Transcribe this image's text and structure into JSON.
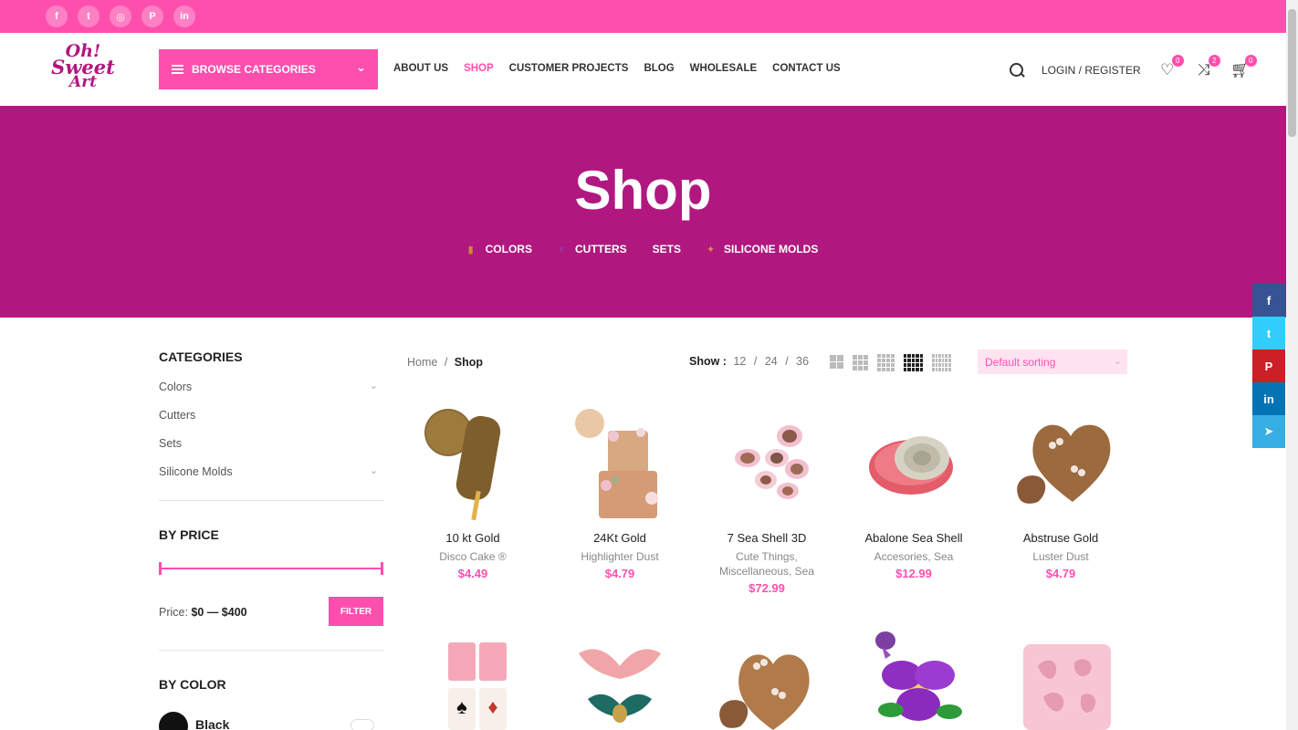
{
  "topbar": {
    "social": [
      {
        "icon": "facebook-icon",
        "glyph": "f"
      },
      {
        "icon": "twitter-icon",
        "glyph": "t"
      },
      {
        "icon": "instagram-icon",
        "glyph": "◎"
      },
      {
        "icon": "pinterest-icon",
        "glyph": "P"
      },
      {
        "icon": "linkedin-icon",
        "glyph": "in"
      }
    ]
  },
  "header": {
    "logo": {
      "line1": "Oh!",
      "line2": "Sweet",
      "line3": "Art"
    },
    "browse_label": "BROWSE CATEGORIES",
    "nav": [
      "ABOUT US",
      "SHOP",
      "CUSTOMER PROJECTS",
      "BLOG",
      "WHOLESALE",
      "CONTACT US"
    ],
    "active_nav": "SHOP",
    "login_label": "LOGIN / REGISTER",
    "wishlist_count": "0",
    "compare_count": "2",
    "cart_count": "0"
  },
  "hero": {
    "title": "Shop",
    "categories": [
      "COLORS",
      "CUTTERS",
      "SETS",
      "SILICONE MOLDS"
    ]
  },
  "sidebar": {
    "categories_title": "CATEGORIES",
    "categories": [
      "Colors",
      "Cutters",
      "Sets",
      "Silicone Molds"
    ],
    "price_title": "BY PRICE",
    "price_prefix": "Price:",
    "price_range": "$0 — $400",
    "filter_label": "FILTER",
    "color_title": "BY COLOR",
    "first_color": "Black"
  },
  "toolbar": {
    "breadcrumb_home": "Home",
    "breadcrumb_sep": "/",
    "breadcrumb_current": "Shop",
    "show_label": "Show :",
    "show_options": [
      "12",
      "24",
      "36"
    ],
    "sort_label": "Default sorting"
  },
  "products": [
    {
      "name": "10 kt Gold",
      "category": "Disco Cake ®",
      "price": "$4.49"
    },
    {
      "name": "24Kt Gold",
      "category": "Highlighter Dust",
      "price": "$4.79"
    },
    {
      "name": "7 Sea Shell 3D",
      "category": "Cute Things, Miscellaneous, Sea",
      "price": "$72.99"
    },
    {
      "name": "Abalone Sea Shell",
      "category": "Accesories, Sea",
      "price": "$12.99"
    },
    {
      "name": "Abstruse Gold",
      "category": "Luster Dust",
      "price": "$4.79"
    }
  ],
  "colors": {
    "brand_pink": "#ff4fae",
    "brand_magenta": "#b0187f"
  }
}
